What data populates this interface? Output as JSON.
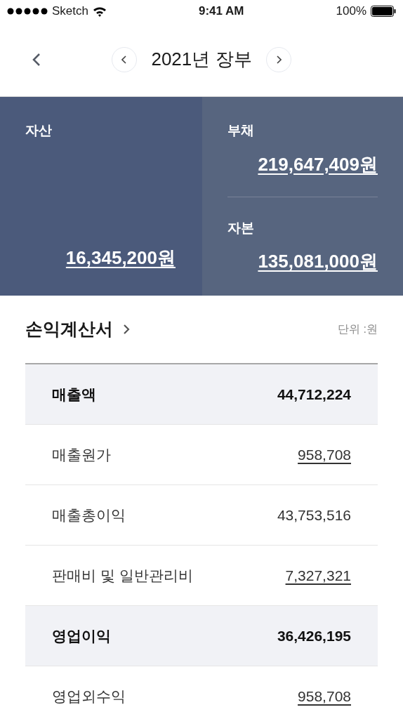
{
  "status_bar": {
    "carrier": "Sketch",
    "time": "9:41 AM",
    "battery": "100%"
  },
  "header": {
    "title": "2021년 장부"
  },
  "balance": {
    "assets": {
      "label": "자산",
      "value": "16,345,200원"
    },
    "liabilities": {
      "label": "부채",
      "value": "219,647,409원"
    },
    "equity": {
      "label": "자본",
      "value": "135,081,000원"
    }
  },
  "income_statement": {
    "title": "손익계산서",
    "unit": "단위 :원",
    "rows": [
      {
        "label": "매출액",
        "value": "44,712,224",
        "kind": "subtotal",
        "linked": false
      },
      {
        "label": "매출원가",
        "value": "958,708",
        "kind": "item",
        "linked": true
      },
      {
        "label": "매출총이익",
        "value": "43,753,516",
        "kind": "item",
        "linked": false
      },
      {
        "label": "판매비 및 일반관리비",
        "value": "7,327,321",
        "kind": "item",
        "linked": true
      },
      {
        "label": "영업이익",
        "value": "36,426,195",
        "kind": "subtotal",
        "linked": false
      },
      {
        "label": "영업외수익",
        "value": "958,708",
        "kind": "item",
        "linked": true
      }
    ]
  }
}
